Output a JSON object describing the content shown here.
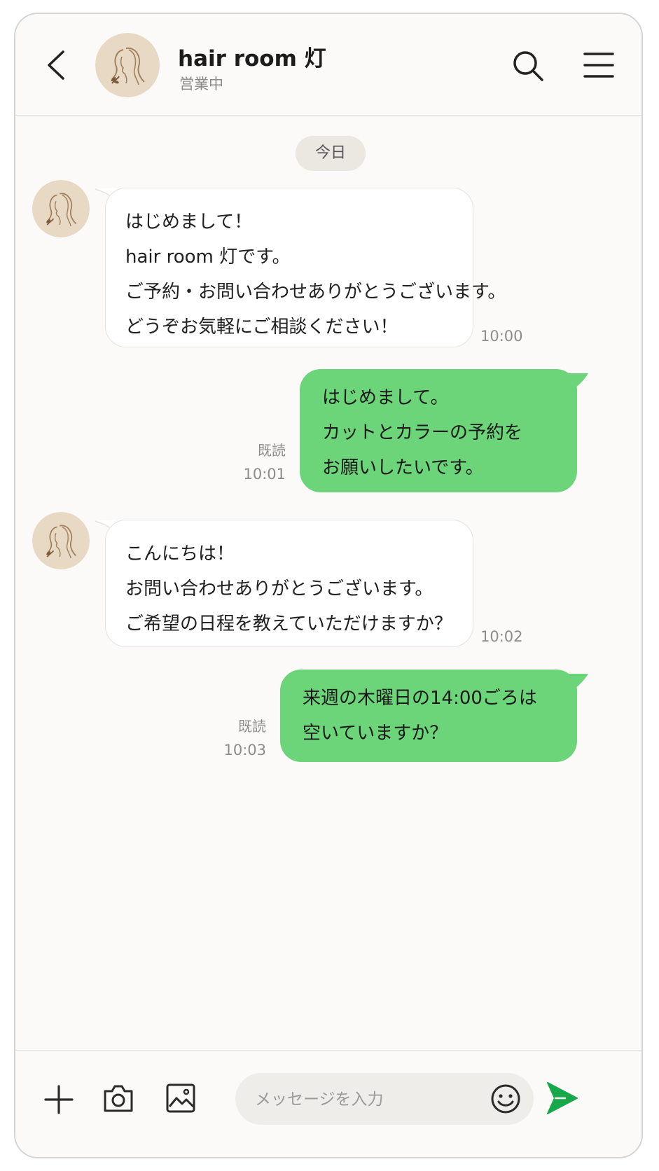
{
  "header": {
    "back_icon": "chevron-left-icon",
    "shop_name": "hair room 灯",
    "status": "営業中",
    "search_icon": "search-icon",
    "menu_icon": "hamburger-menu-icon"
  },
  "chat": {
    "date_label": "今日",
    "messages": [
      {
        "direction": "incoming",
        "lines": [
          "はじめまして！",
          "hair room 灯です。",
          "ご予約・お問い合わせありがとうございます。",
          "どうぞお気軽にご相談ください！"
        ],
        "time": "10:00"
      },
      {
        "direction": "outgoing",
        "lines": [
          "はじめまして。",
          "カットとカラーの予約を",
          "お願いしたいです。"
        ],
        "read": "既読",
        "time": "10:01"
      },
      {
        "direction": "incoming",
        "lines": [
          "こんにちは！",
          "お問い合わせありがとうございます。",
          "ご希望の日程を教えていただけますか？"
        ],
        "time": "10:02"
      },
      {
        "direction": "outgoing",
        "lines": [
          "来週の木曜日の14:00ごろは",
          "空いていますか？"
        ],
        "read": "既読",
        "time": "10:03"
      }
    ]
  },
  "composer": {
    "placeholder": "メッセージを入力",
    "add_icon": "plus-icon",
    "camera_icon": "camera-icon",
    "image_icon": "image-icon",
    "emoji_icon": "emoji-icon",
    "send_icon": "send-icon"
  },
  "colors": {
    "outgoing_bubble": "#6cd479",
    "incoming_bubble": "#ffffff",
    "background": "#fbfaf8",
    "send_accent": "#18a84a"
  }
}
